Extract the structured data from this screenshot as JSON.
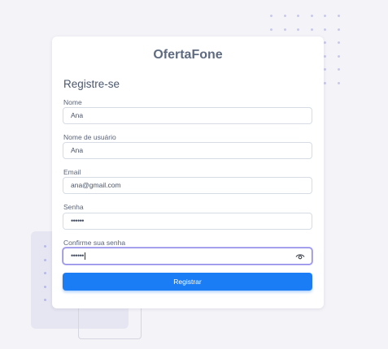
{
  "app": {
    "brand": "OfertaFone"
  },
  "form": {
    "title": "Registre-se",
    "fields": [
      {
        "label": "Nome",
        "value": "Ana",
        "type": "text"
      },
      {
        "label": "Nome de usuário",
        "value": "Ana",
        "type": "text"
      },
      {
        "label": "Email",
        "value": "ana@gmail.com",
        "type": "email"
      },
      {
        "label": "Senha",
        "value": "••••••",
        "type": "password"
      },
      {
        "label": "Confirme sua senha",
        "value": "••••••",
        "type": "password"
      }
    ],
    "submit_label": "Registrar"
  },
  "icons": {
    "toggle_password": "eye-icon"
  },
  "colors": {
    "primary": "#1a7df5",
    "focus": "#8f89e8"
  }
}
